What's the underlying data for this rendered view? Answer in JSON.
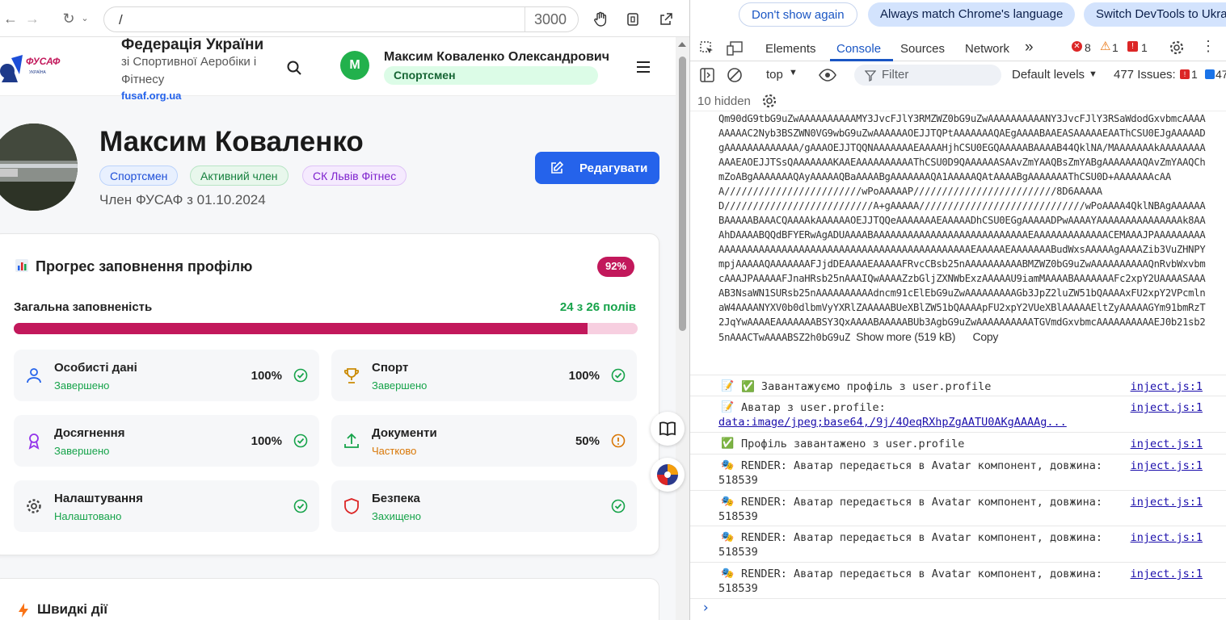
{
  "browser": {
    "url": "/",
    "port": "3000"
  },
  "header": {
    "logo_text": "ФУСАФ",
    "logo_sub": "УКРАЇНА",
    "title": "Федерація України",
    "subtitle": "зі Спортивної Аеробіки і Фітнесу",
    "link": "fusaf.org.ua",
    "user_initial": "М",
    "user_name": "Максим Коваленко Олександрович",
    "user_role": "Спортсмен"
  },
  "profile": {
    "name": "Максим Коваленко",
    "badges": [
      "Спортсмен",
      "Активний член",
      "СК Львів Фітнес"
    ],
    "member_since": "Член ФУСАФ з 01.10.2024",
    "edit_label": "Редагувати"
  },
  "progress": {
    "title": "Прогрес заповнення профілю",
    "percent_label": "92%",
    "overall_label": "Загальна заповненість",
    "overall_count": "24 з 26 полів",
    "fill_fraction": 0.92,
    "sections": [
      {
        "icon": "user-icon",
        "title": "Особисті дані",
        "status": "Завершено",
        "pct": "100%",
        "state": "done"
      },
      {
        "icon": "trophy-icon",
        "title": "Спорт",
        "status": "Завершено",
        "pct": "100%",
        "state": "done"
      },
      {
        "icon": "award-icon",
        "title": "Досягнення",
        "status": "Завершено",
        "pct": "100%",
        "state": "done"
      },
      {
        "icon": "upload-icon",
        "title": "Документи",
        "status": "Частково",
        "pct": "50%",
        "state": "partial"
      },
      {
        "icon": "gear-icon",
        "title": "Налаштування",
        "status": "Налаштовано",
        "pct": "",
        "state": "done"
      },
      {
        "icon": "shield-icon",
        "title": "Безпека",
        "status": "Захищено",
        "pct": "",
        "state": "done"
      }
    ]
  },
  "quick": {
    "title": "Швидкі дії"
  },
  "devtools": {
    "infobar": [
      "Don't show again",
      "Always match Chrome's language",
      "Switch DevTools to Ukra"
    ],
    "tabs": [
      "Elements",
      "Console",
      "Sources",
      "Network"
    ],
    "more_tabs": "»",
    "error_count": "8",
    "warning_count": "1",
    "issue_count": "1",
    "context": "top",
    "filter_placeholder": "Filter",
    "levels": "Default levels",
    "issues_label": "477 Issues:",
    "issues_errors": "1",
    "issues_info": "47",
    "hidden": "10 hidden",
    "base64_text": "Qm90dG9tbG9uZwAAAAAAAAAAMY3JvcFJlY3RMZWZ0bG9uZwAAAAAAAAAANY3JvcFJlY3RSaWdodGxvbmcAAAAAAAAAC2Nyb3BSZWN0VG9wbG9uZwAAAAAAOEJJTQPtAAAAAAAQAEgAAAABAAEASAAAAAEAAThCSU0EJgAAAAADgAAAAAAAAAAAAA/gAAAOEJJTQQNAAAAAAAEAAAAHjhCSU0EGQAAAAABAAAAB44QklNA/MAAAAAAAkAAAAAAAAAAAEAOEJJTSsQAAAAAAAKAAEAAAAAAAAAAThCSU0D9QAAAAAASAAvZmYAAQBsZmYABgAAAAAAAQAvZmYAAQChmZoABgAAAAAAAQAyAAAAAQBaAAAABgAAAAAAAQA1AAAAAQAtAAAABgAAAAAAAThCSU0D+AAAAAAAcAAA////////////////////////wPoAAAAAP/////////////////////////8D6AAAAAD//////////////////////////A+gAAAAA/////////////////////////////wPoAAAA4QklNBAgAAAAAABAAAAABAAACQAAAAkAAAAAAOEJJTQQeAAAAAAAEAAAAADhCSU0EGgAAAAADPwAAAAYAAAAAAAAAAAAAAAk8AAAhDAAAABQQdBFYERwAgADUAAAABAAAAAAAAAAAAAAAAAAAAAAAAAAAEAAAAAAAAAAAAACEMAAAJPAAAAAAAAAAAAAAAAAAAAAAAAAAAAAAAAAAAAAAAAAAAAAAAAAAAAAEAAAAAEAAAAAAABudWxsAAAAAgAAAAZib3VuZHNPYmpjAAAAAQAAAAAAAFJjdDEAAAAEAAAAAFRvcCBsb25nAAAAAAAAAABMZWZ0bG9uZwAAAAAAAAAAQnRvbWxvbmcAAAJPAAAAAFJnaHRsb25nAAAIQwAAAAZzbGljZXNWbExzAAAAAU9iamMAAAABAAAAAAAFc2xpY2UAAAASAAAAB3NsaWN1SURsb25nAAAAAAAAAAdncm91cElEbG9uZwAAAAAAAAAGb3JpZ2luZW51bQAAAAxFU2xpY2VPcmlnaW4AAAANYXV0b0dlbmVyYXRlZAAAAABUeXBlZW51bQAAAApFU2xpY2VUeXBlAAAAAEltZyAAAAAGYm91bmRzT2JqYwAAAAEAAAAAAABSY3QxAAAABAAAAABUb3AgbG9uZwAAAAAAAAAATGVmdGxvbmcAAAAAAAAAAEJ0b21sb25nAAACTwAAAABSZ2h0bG9uZ",
    "show_more": "Show more (519 kB)",
    "copy": "Copy",
    "logs": [
      {
        "emoji": "📝",
        "text": "✅ Завантажуємо профіль з user.profile",
        "src": "inject.js:1"
      },
      {
        "emoji": "📝",
        "text": "Аватар з user.profile:",
        "cont": "data:image/jpeg;base64,/9j/4QeqRXhpZgAATU0AKgAAAAg...",
        "src": "inject.js:1"
      },
      {
        "emoji": "✅",
        "text": "Профіль завантажено з user.profile",
        "src": "inject.js:1"
      },
      {
        "emoji": "🎭",
        "text": "RENDER: Аватар передається в Avatar компонент, довжина:",
        "cont": "518539",
        "src": "inject.js:1"
      },
      {
        "emoji": "🎭",
        "text": "RENDER: Аватар передається в Avatar компонент, довжина:",
        "cont": "518539",
        "src": "inject.js:1"
      },
      {
        "emoji": "🎭",
        "text": "RENDER: Аватар передається в Avatar компонент, довжина:",
        "cont": "518539",
        "src": "inject.js:1"
      },
      {
        "emoji": "🎭",
        "text": "RENDER: Аватар передається в Avatar компонент, довжина:",
        "cont": "518539",
        "src": "inject.js:1"
      }
    ],
    "prompt": "›"
  },
  "colors": {
    "accent": "#c2185b",
    "primary": "#2563eb",
    "success": "#16a34a",
    "warning": "#d97706"
  }
}
